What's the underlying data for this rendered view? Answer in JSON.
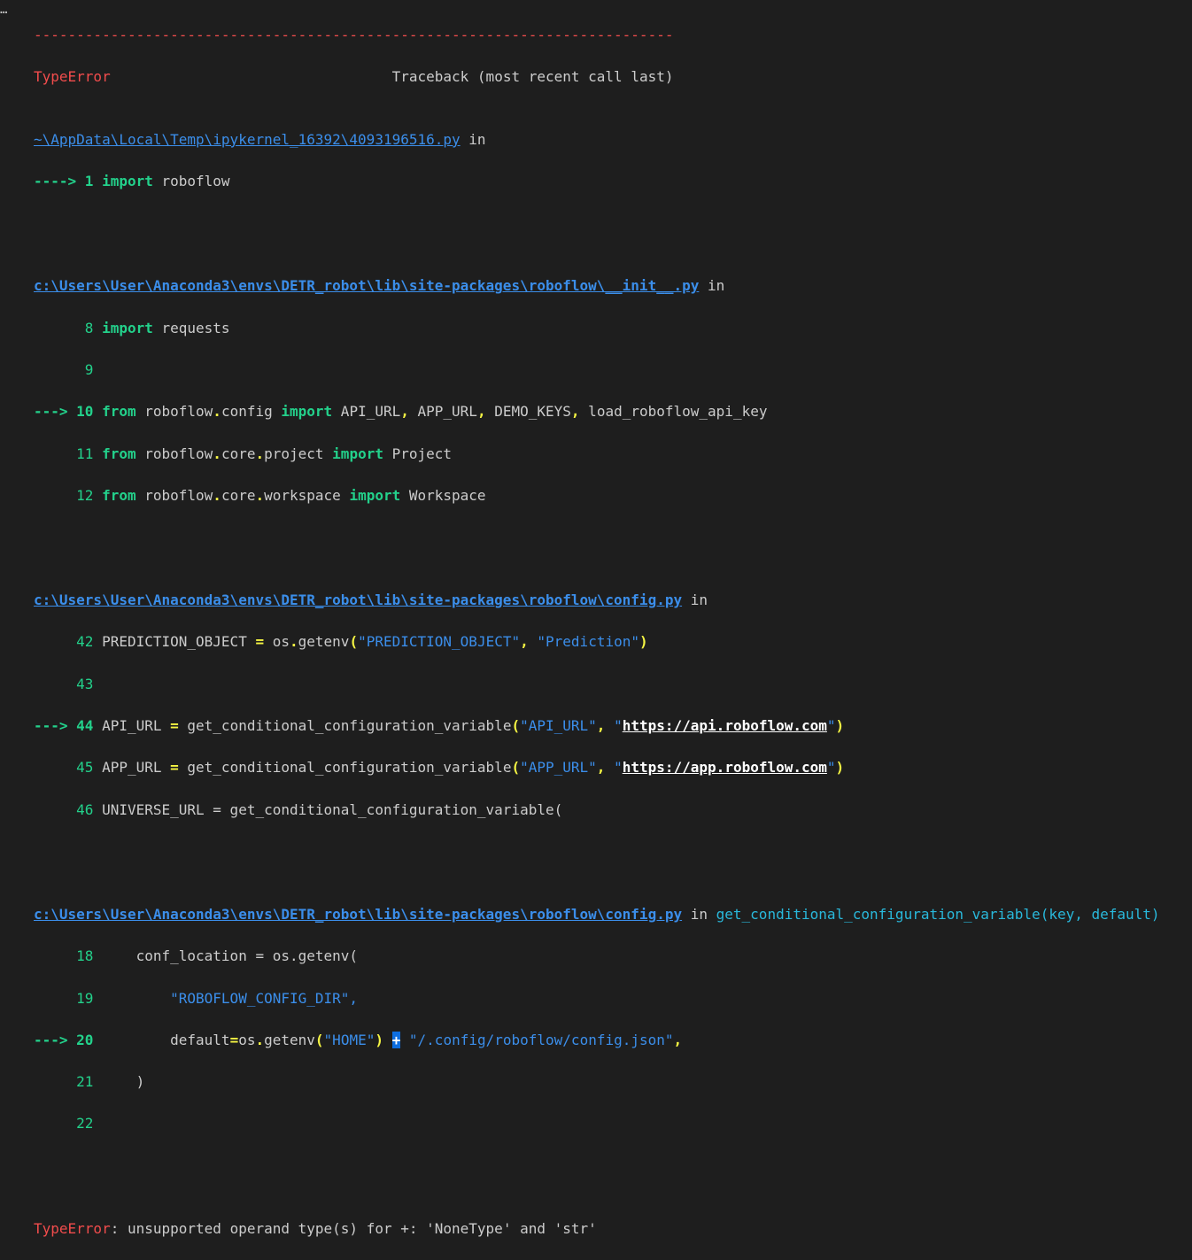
{
  "menu_icon": "ellipsis-icon",
  "traceback": {
    "separator": "---------------------------------------------------------------------------",
    "error_type": "TypeError",
    "header_gap": "                                 ",
    "header_text": "Traceback (most recent call last)",
    "in_word": " in",
    "frames": [
      {
        "file": "~\\AppData\\Local\\Temp\\ipykernel_16392\\4093196516.py",
        "func": ""
      },
      {
        "file": "c:\\Users\\User\\Anaconda3\\envs\\DETR_robot\\lib\\site-packages\\roboflow\\__init__.py",
        "func": ""
      },
      {
        "file": "c:\\Users\\User\\Anaconda3\\envs\\DETR_robot\\lib\\site-packages\\roboflow\\config.py",
        "func": ""
      },
      {
        "file": "c:\\Users\\User\\Anaconda3\\envs\\DETR_robot\\lib\\site-packages\\roboflow\\config.py",
        "func": "get_conditional_configuration_variable(key, default)"
      }
    ],
    "f0": {
      "arrow": "----> 1 ",
      "kw_import": "import",
      "rest": " roboflow"
    },
    "f1": {
      "l8_no": "      8 ",
      "l8_kw": "import",
      "l8_rest": " requests",
      "l9_no": "      9",
      "l10_arrow": "---> 10 ",
      "kw_from": "from",
      "l10_mod": " roboflow",
      "dot": ".",
      "l10_sub": "config ",
      "kw_import": "import",
      "l10_a": " API_URL",
      "comma": ",",
      "l10_b": " APP_URL",
      "l10_c": " DEMO_KEYS",
      "l10_d": " load_roboflow_api_key",
      "l11_no": "     11 ",
      "l11_mod": " roboflow",
      "l11_core": "core",
      "l11_sub": "project ",
      "l11_rest": " Project",
      "l12_no": "     12 ",
      "l12_sub": "workspace ",
      "l12_rest": " Workspace"
    },
    "f2": {
      "l42_no": "     42 ",
      "l42_a": "PREDICTION_OBJECT ",
      "eq": "=",
      "l42_b": " os",
      "dot": ".",
      "l42_c": "getenv",
      "lp": "(",
      "l42_s1": "\"PREDICTION_OBJECT\"",
      "comma": ",",
      "sp": " ",
      "l42_s2": "\"Prediction\"",
      "rp": ")",
      "l43_no": "     43",
      "l44_arrow": "---> 44 ",
      "l44_a": "API_URL ",
      "fn": " get_conditional_configuration_variable",
      "l44_s1": "\"API_URL\"",
      "q": "\"",
      "l44_url": "https://api.roboflow.com",
      "l45_no": "     45 ",
      "l45_a": "APP_URL ",
      "l45_s1": "\"APP_URL\"",
      "l45_url": "https://app.roboflow.com",
      "l46_no": "     46 ",
      "l46_a": "UNIVERSE_URL = get_conditional_configuration_variable("
    },
    "f3": {
      "l18_no": "     18 ",
      "l18_a": "    conf_location = os.getenv(",
      "l19_no": "     19 ",
      "l19_ind": "        ",
      "l19_s": "\"ROBOFLOW_CONFIG_DIR\",",
      "l20_arrow": "---> 20 ",
      "l20_ind": "        ",
      "l20_a": "default",
      "eq": "=",
      "l20_b": "os",
      "dot": ".",
      "l20_c": "getenv",
      "lp": "(",
      "l20_s1": "\"HOME\"",
      "rp": ")",
      "sp": " ",
      "plus": "+",
      "l20_s2": "\"/.config/roboflow/config.json\"",
      "comma": ",",
      "l21_no": "     21 ",
      "l21_a": "    )",
      "l22_no": "     22"
    },
    "final_error_type": "TypeError",
    "final_message": ": unsupported operand type(s) for +: 'NoneType' and 'str'"
  }
}
